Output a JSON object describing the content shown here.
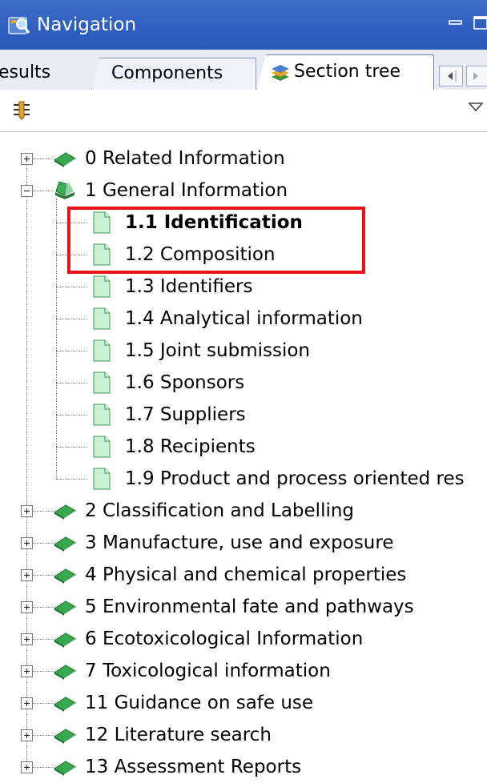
{
  "window": {
    "title": "Navigation"
  },
  "tabs": [
    {
      "label": "esults",
      "active": false
    },
    {
      "label": "Components",
      "active": false
    },
    {
      "label": "Section tree",
      "active": true
    }
  ],
  "tree": [
    {
      "label": "0 Related Information",
      "level": 0,
      "expanded": false,
      "icon": "book-icon"
    },
    {
      "label": "1 General Information",
      "level": 0,
      "expanded": true,
      "icon": "book-open-icon"
    },
    {
      "label": "1.1 Identification",
      "level": 1,
      "bold": true,
      "icon": "document-icon"
    },
    {
      "label": "1.2 Composition",
      "level": 1,
      "icon": "document-icon"
    },
    {
      "label": "1.3 Identifiers",
      "level": 1,
      "icon": "document-icon"
    },
    {
      "label": "1.4 Analytical information",
      "level": 1,
      "icon": "document-icon"
    },
    {
      "label": "1.5 Joint submission",
      "level": 1,
      "icon": "document-icon"
    },
    {
      "label": "1.6 Sponsors",
      "level": 1,
      "icon": "document-icon"
    },
    {
      "label": "1.7 Suppliers",
      "level": 1,
      "icon": "document-icon"
    },
    {
      "label": "1.8 Recipients",
      "level": 1,
      "icon": "document-icon"
    },
    {
      "label": "1.9 Product and process oriented res",
      "level": 1,
      "icon": "document-icon"
    },
    {
      "label": "2 Classification and Labelling",
      "level": 0,
      "expanded": false,
      "icon": "book-icon"
    },
    {
      "label": "3 Manufacture, use and exposure",
      "level": 0,
      "expanded": false,
      "icon": "book-icon"
    },
    {
      "label": "4 Physical and chemical properties",
      "level": 0,
      "expanded": false,
      "icon": "book-icon"
    },
    {
      "label": "5 Environmental fate and pathways",
      "level": 0,
      "expanded": false,
      "icon": "book-icon"
    },
    {
      "label": "6 Ecotoxicological Information",
      "level": 0,
      "expanded": false,
      "icon": "book-icon"
    },
    {
      "label": "7 Toxicological information",
      "level": 0,
      "expanded": false,
      "icon": "book-icon"
    },
    {
      "label": "11 Guidance on safe use",
      "level": 0,
      "expanded": false,
      "icon": "book-icon"
    },
    {
      "label": "12 Literature search",
      "level": 0,
      "expanded": false,
      "icon": "book-icon"
    },
    {
      "label": "13 Assessment Reports",
      "level": 0,
      "expanded": false,
      "icon": "book-icon"
    }
  ],
  "colors": {
    "titlebar": "#2e5fbf",
    "highlight": "#e8131a",
    "book": "#2e9e4a",
    "document": "#c9f0d2"
  }
}
